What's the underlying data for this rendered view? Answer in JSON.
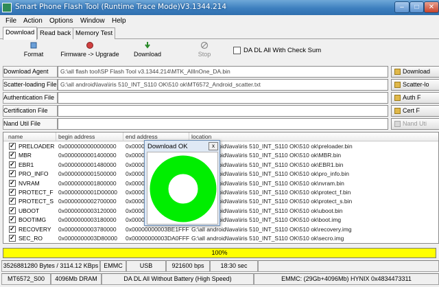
{
  "window": {
    "title": "Smart Phone Flash Tool (Runtime Trace Mode)V3.1344.214",
    "min": "–",
    "max": "□",
    "close": "✕"
  },
  "menu": [
    "File",
    "Action",
    "Options",
    "Window",
    "Help"
  ],
  "tabs": [
    "Download",
    "Read back",
    "Memory Test"
  ],
  "toolbar": {
    "format": "Format",
    "firmware_upgrade": "Firmware -> Upgrade",
    "download": "Download",
    "stop": "Stop",
    "da_dl_label": "DA DL All With Check Sum"
  },
  "files": {
    "download_agent": {
      "label": "Download Agent",
      "value": "G:\\all flash tool\\SP Flash Tool v3.1344.214\\MTK_AllInOne_DA.bin"
    },
    "scatter": {
      "label": "Scatter-loading File",
      "value": "G:\\all android\\lava\\iris 510_INT_S110 OK\\510 ok\\MT6572_Android_scatter.txt"
    },
    "authentication": {
      "label": "Authentication File",
      "value": ""
    },
    "certification": {
      "label": "Certification File",
      "value": ""
    },
    "nand_util": {
      "label": "Nand Util File",
      "value": ""
    }
  },
  "side_buttons": [
    "Download",
    "Scatter-lo",
    "Auth F",
    "Cert F",
    "Nand Uti"
  ],
  "table": {
    "headers": [
      "name",
      "begin address",
      "end address",
      "location"
    ],
    "rows": [
      {
        "checked": true,
        "name": "PRELOADER",
        "begin": "0x0000000000000000",
        "end": "0x0000000000",
        "location": "G:\\all android\\lava\\iris 510_INT_S110 OK\\510 ok\\preloader.bin"
      },
      {
        "checked": true,
        "name": "MBR",
        "begin": "0x0000000001400000",
        "end": "0x0000000001",
        "location": "G:\\all android\\lava\\iris 510_INT_S110 OK\\510 ok\\MBR.bin"
      },
      {
        "checked": true,
        "name": "EBR1",
        "begin": "0x0000000001480000",
        "end": "0x0000000001",
        "location": "G:\\all android\\lava\\iris 510_INT_S110 OK\\510 ok\\EBR1.bin"
      },
      {
        "checked": true,
        "name": "PRO_INFO",
        "begin": "0x0000000001500000",
        "end": "0x0000000001",
        "location": "G:\\all android\\lava\\iris 510_INT_S110 OK\\510 ok\\pro_info.bin"
      },
      {
        "checked": true,
        "name": "NVRAM",
        "begin": "0x0000000001800000",
        "end": "0x0000000001",
        "location": "G:\\all android\\lava\\iris 510_INT_S110 OK\\510 ok\\nvram.bin"
      },
      {
        "checked": true,
        "name": "PROTECT_F",
        "begin": "0x0000000001D00000",
        "end": "0x0000000002",
        "location": "G:\\all android\\lava\\iris 510_INT_S110 OK\\510 ok\\protect_f.bin"
      },
      {
        "checked": true,
        "name": "PROTECT_S",
        "begin": "0x0000000002700000",
        "end": "0x0000000003",
        "location": "G:\\all android\\lava\\iris 510_INT_S110 OK\\510 ok\\protect_s.bin"
      },
      {
        "checked": true,
        "name": "UBOOT",
        "begin": "0x0000000003120000",
        "end": "0x0000000003",
        "location": "G:\\all android\\lava\\iris 510_INT_S110 OK\\510 ok\\uboot.bin"
      },
      {
        "checked": true,
        "name": "BOOTIMG",
        "begin": "0x0000000003180000",
        "end": "0x0000000003",
        "location": "G:\\all android\\lava\\iris 510_INT_S110 OK\\510 ok\\boot.img"
      },
      {
        "checked": true,
        "name": "RECOVERY",
        "begin": "0x0000000003780000",
        "end": "0x00000000003BE1FFF",
        "location": "G:\\all android\\lava\\iris 510_INT_S110 OK\\510 ok\\recovery.img"
      },
      {
        "checked": true,
        "name": "SEC_RO",
        "begin": "0x0000000003D80000",
        "end": "0x00000000003DA0FFF",
        "location": "G:\\all android\\lava\\iris 510_INT_S110 OK\\510 ok\\secro.img"
      }
    ]
  },
  "progress": {
    "text": "100%",
    "percent": 100,
    "color": "#ffff00"
  },
  "status1": [
    "3526881280 Bytes / 3114.12 KBps",
    "EMMC",
    "USB",
    "921600 bps",
    "18:30 sec"
  ],
  "status2": [
    "MT6572_S00",
    "4096Mb DRAM",
    "DA DL All Without Battery (High Speed)",
    "EMMC: (29Gb+4096Mb) HYNIX 0x4834473311"
  ],
  "dialog": {
    "title": "Download OK",
    "close": "x",
    "ring_color": "#00ee00"
  }
}
